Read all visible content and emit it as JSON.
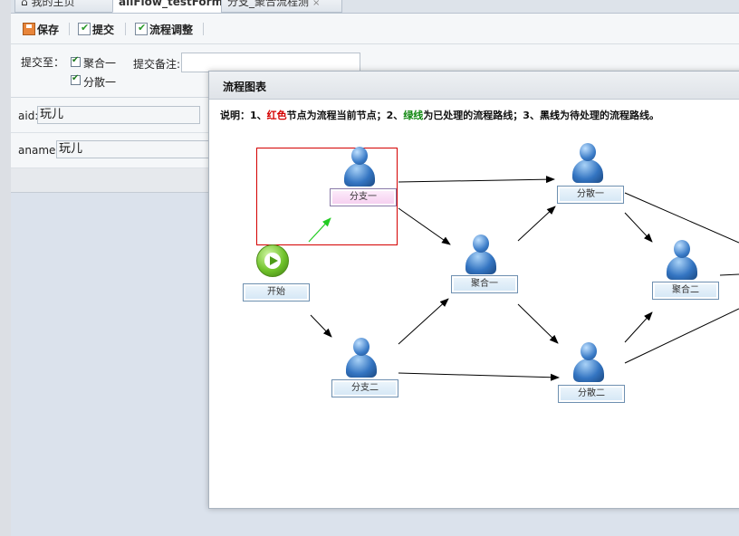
{
  "tabs": [
    {
      "label": "我的主页",
      "icon": "home-icon"
    },
    {
      "label": "allFlow_testForm",
      "active": true
    },
    {
      "label": "分支_聚合流程测"
    }
  ],
  "toolbar": {
    "save_label": "保存",
    "submit_label": "提交",
    "adjust_label": "流程调整"
  },
  "form": {
    "submit_to_label": "提交至：",
    "targets": [
      {
        "label": "聚合一",
        "checked": true
      },
      {
        "label": "分散一",
        "checked": true
      }
    ],
    "remark_label": "提交备注:",
    "remark_value": "",
    "aid_label": "aid:",
    "aid_value": "玩儿",
    "aname_label": "aname:",
    "aname_value": "玩儿"
  },
  "modal": {
    "title": "流程图表",
    "legend": {
      "prefix": "说明：1、",
      "red": "红色",
      "t1": "节点为流程当前节点；2、",
      "green": "绿线",
      "t2": "为已处理的流程路线；3、",
      "black": "黑线",
      "t3": "为待处理的流程路线。"
    },
    "nodes": {
      "start": "开始",
      "branch1": "分支一",
      "branch2": "分支二",
      "merge1": "聚合一",
      "merge2": "聚合二",
      "scatter1": "分散一",
      "scatter2": "分散二"
    },
    "colors": {
      "current": "#d40000",
      "done": "#22aa22",
      "pending": "#000000"
    }
  }
}
